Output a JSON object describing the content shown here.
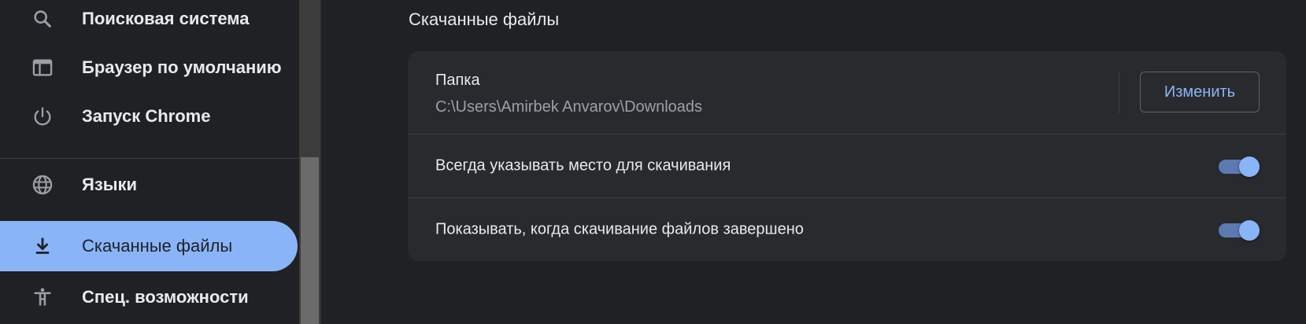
{
  "sidebar": {
    "items": [
      {
        "label": "Поисковая система",
        "icon": "search-icon"
      },
      {
        "label": "Браузер по умолчанию",
        "icon": "browser-window-icon"
      },
      {
        "label": "Запуск Chrome",
        "icon": "power-icon"
      },
      {
        "label": "Языки",
        "icon": "globe-icon"
      },
      {
        "label": "Скачанные файлы",
        "icon": "download-icon",
        "active": true
      },
      {
        "label": "Спец. возможности",
        "icon": "accessibility-icon"
      }
    ]
  },
  "main": {
    "section_title": "Скачанные файлы",
    "folder": {
      "label": "Папка",
      "path": "C:\\Users\\Amirbek Anvarov\\Downloads",
      "change_button": "Изменить"
    },
    "toggles": [
      {
        "label": "Всегда указывать место для скачивания",
        "on": true
      },
      {
        "label": "Показывать, когда скачивание файлов завершено",
        "on": true
      }
    ]
  },
  "colors": {
    "background": "#202124",
    "card": "#292a2d",
    "accent": "#8ab4f8",
    "text": "#e8eaed",
    "secondary_text": "#9aa0a6"
  }
}
